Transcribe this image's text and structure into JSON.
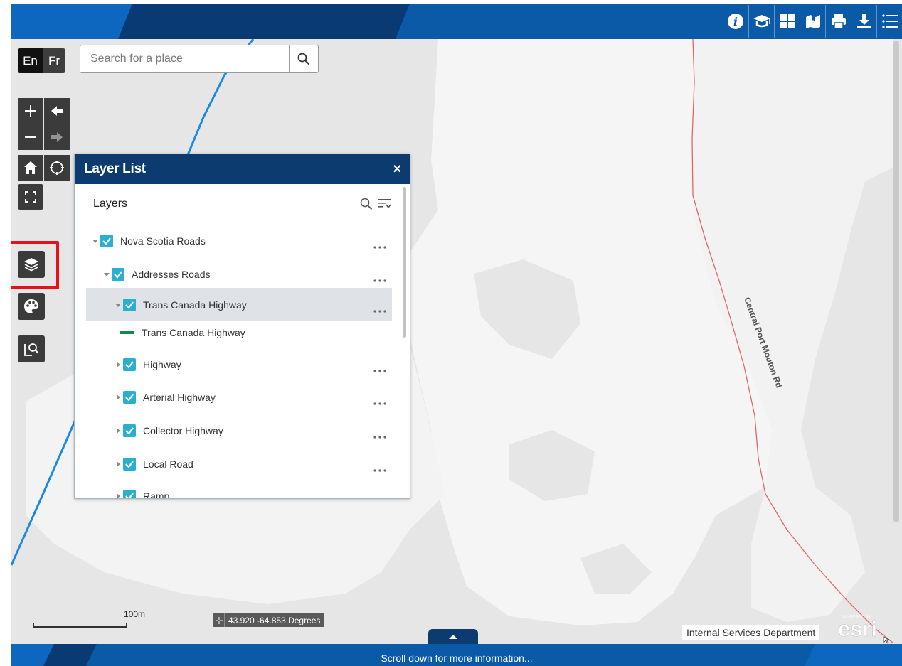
{
  "language": {
    "en": "En",
    "fr": "Fr"
  },
  "search": {
    "placeholder": "Search for a place"
  },
  "map_label": "Central Port Mouton Rd",
  "layer_list": {
    "title": "Layer List",
    "close": "×",
    "subtitle": "Layers",
    "items": [
      {
        "label": "Nova Scotia Roads",
        "checked": true,
        "expanded": true
      },
      {
        "label": "Addresses Roads",
        "checked": true,
        "expanded": true
      },
      {
        "label": "Trans Canada Highway",
        "checked": true,
        "expanded": true,
        "selected": true
      },
      {
        "label": "Highway",
        "checked": true,
        "expanded": false
      },
      {
        "label": "Arterial Highway",
        "checked": true,
        "expanded": false
      },
      {
        "label": "Collector Highway",
        "checked": true,
        "expanded": false
      },
      {
        "label": "Local Road",
        "checked": true,
        "expanded": false
      },
      {
        "label": "Ramp",
        "checked": true,
        "expanded": false
      }
    ],
    "legend": {
      "label": "Trans Canada Highway",
      "color": "#0f8a4a"
    }
  },
  "scale": {
    "label": "100m"
  },
  "coordinates": {
    "label": "43.920 -64.853 Degrees"
  },
  "attribution": "Internal Services Department",
  "esri": {
    "top": "POWERED BY",
    "logo": "esri"
  },
  "footer": {
    "text": "Scroll down for more information..."
  },
  "colors": {
    "header": "#0b5aa8",
    "panel_header": "#0b3b6f",
    "checkbox": "#2bafd0",
    "highlight": "#e8101a",
    "map_bg": "#e6e6e6",
    "land": "#f5f5f5",
    "road_red": "#e06666",
    "road_blue": "#1b8ae0"
  }
}
